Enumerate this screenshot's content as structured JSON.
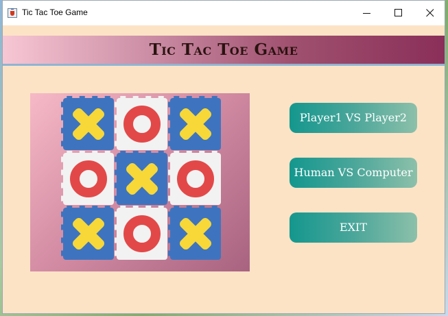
{
  "window": {
    "title": "Tic Tac Toe Game",
    "controls": [
      "minimize-icon",
      "maximize-icon",
      "close-icon"
    ]
  },
  "banner": {
    "title": "Tic Tac Toe Game"
  },
  "board_image": {
    "grid": [
      [
        "X",
        "O",
        "X"
      ],
      [
        "O",
        "X",
        "O"
      ],
      [
        "X",
        "O",
        "X"
      ]
    ],
    "colors": {
      "x": "#f7d838",
      "o": "#e34848",
      "blue_tile": "#3e74bf",
      "white_tile": "#f2f2f2"
    }
  },
  "menu": {
    "pvp_label": "Player1 VS Player2",
    "pvc_label": "Human VS Computer",
    "exit_label": "EXIT"
  },
  "colors": {
    "background": "#fde3c6",
    "button_start": "#14978e",
    "button_end": "#8cc0aa",
    "banner_start": "#f7c7d4",
    "banner_end": "#8a2f59"
  }
}
